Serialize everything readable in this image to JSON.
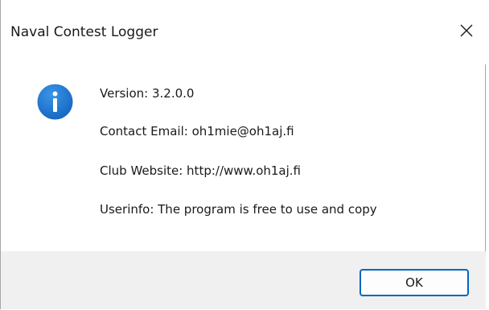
{
  "window": {
    "title": "Naval Contest Logger",
    "close_icon": "close-icon"
  },
  "message": {
    "icon": "info-icon",
    "icon_color": "#1a73c9",
    "lines": [
      "Version: 3.2.0.0",
      "Contact Email: oh1mie@oh1aj.fi",
      "Club Website: http://www.oh1aj.fi",
      "Userinfo: The program is free to use and copy"
    ]
  },
  "footer": {
    "ok_label": "OK",
    "accent_color": "#0067c0"
  }
}
